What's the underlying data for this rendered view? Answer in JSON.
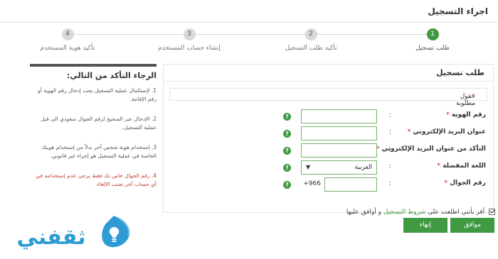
{
  "header": {
    "title": "اجراء التسجيل"
  },
  "steps": [
    {
      "number": "1",
      "label": "طلب تسجيل",
      "active": true
    },
    {
      "number": "2",
      "label": "تأكيد طلب التسجيل",
      "active": false
    },
    {
      "number": "3",
      "label": "إنشاء حساب المستخدم",
      "active": false
    },
    {
      "number": "4",
      "label": "تأكيد هوية المستخدم",
      "active": false
    }
  ],
  "form": {
    "title": "طلب تسجيل",
    "required_note": "حقول مطلوبة",
    "fields": {
      "id_number": {
        "label": "رقم الهوية",
        "value": ""
      },
      "email": {
        "label": "عنوان البريد الإلكتروني",
        "value": ""
      },
      "email_confirm": {
        "label": "التأكد من عنوان البريد الإلكتروني",
        "value": ""
      },
      "language": {
        "label": "اللغة المفضلة",
        "value": "العربية"
      },
      "mobile": {
        "label": "رقم الجوال",
        "prefix": "+966",
        "value": ""
      }
    },
    "colon": ":",
    "help_glyph": "?"
  },
  "instructions": {
    "heading": "الرجاء التأكد من التالي:",
    "items": [
      "1. لإستكمال عملية التسجيل يجب إدخال رقم الهوية أو رقم الإقامة.",
      "2. الإدخال عبر الصحيح لرقم الجوال سعودي الى قبل عملية التسجيل.",
      "3. إستخدام هوية شخص آخر بدلاً من إستخدام هويتك الخاصة في عملية التسجيل هو إجراء غير قانوني.",
      "4. رقم الجوال خاص بك فقط يرجى عدم إستخدامه في أي حساب آخر تجنب الإلغاء."
    ]
  },
  "terms": {
    "text_before": "أقر بأنني اطلعت على",
    "link": "شروط التسجيل",
    "text_after": "و أوافق عليها"
  },
  "buttons": {
    "agree": "موافق",
    "finish": "إنهاء"
  },
  "logo": {
    "text": "ثقفني"
  },
  "colors": {
    "accent": "#3f9a42",
    "required": "#d9534f",
    "warning": "#c0392b",
    "logo_blue": "#2f9bd4"
  }
}
